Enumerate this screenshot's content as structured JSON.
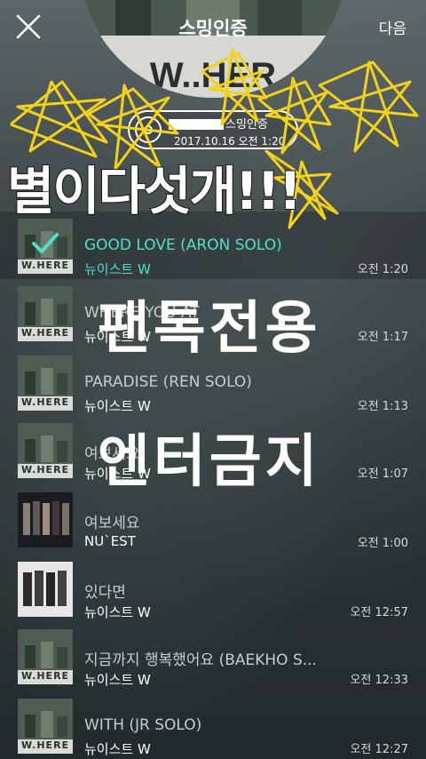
{
  "header": {
    "next_label": "다음",
    "album_title": "스밍인증"
  },
  "badge": {
    "cert_label": "스밍인증",
    "timestamp": "2017.10.16 오전 1:20"
  },
  "album_cover_text": "W..HER",
  "songs": [
    {
      "title": "GOOD LOVE (ARON SOLO)",
      "artist": "뉴이스트 W",
      "time": "오전 1:20",
      "thumb": "W.HERE",
      "selected": true
    },
    {
      "title": "WHERE YOU AT",
      "artist": "뉴이스트 W",
      "time": "오전 1:17",
      "thumb": "W.HERE"
    },
    {
      "title": "PARADISE (REN SOLO)",
      "artist": "뉴이스트 W",
      "time": "오전 1:13",
      "thumb": "W.HERE"
    },
    {
      "title": "여보세요",
      "artist": "뉴이스트 W",
      "time": "오전 1:07",
      "thumb": "W.HERE"
    },
    {
      "title": "여보세요",
      "artist": "NU`EST",
      "time": "오전 1:00",
      "thumb": ""
    },
    {
      "title": "있다면",
      "artist": "뉴이스트 W",
      "time": "오전 12:57",
      "thumb": ""
    },
    {
      "title": "지금까지 행복했어요 (BAEKHO S...",
      "artist": "뉴이스트 W",
      "time": "오전 12:33",
      "thumb": "W.HERE"
    },
    {
      "title": "WITH (JR SOLO)",
      "artist": "뉴이스트 W",
      "time": "오전 12:27",
      "thumb": "W.HERE"
    }
  ],
  "overlay_text": {
    "line1": "별이다섯개!!!",
    "line2": "팬톡전용",
    "line3": "엔터금지"
  },
  "colors": {
    "accent": "#4ee0cc",
    "scribble": "#f2d21a"
  }
}
